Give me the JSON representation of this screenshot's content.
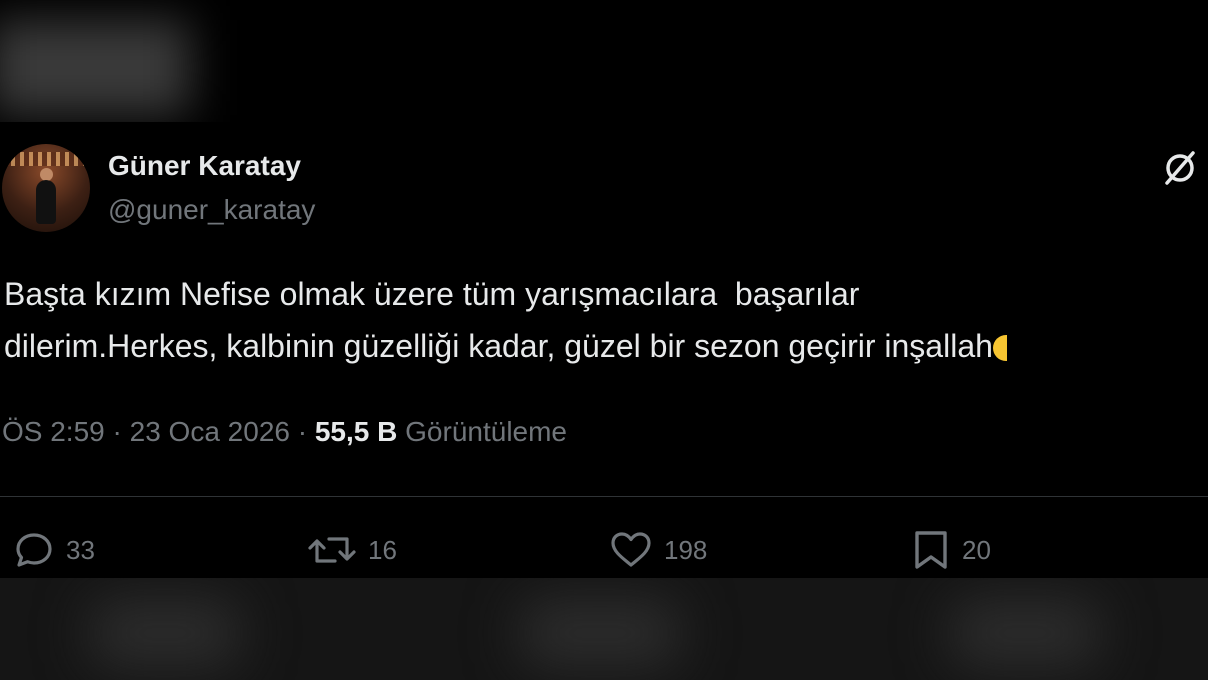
{
  "tweet": {
    "display_name": "Güner Karatay",
    "handle": "@guner_karatay",
    "text_line1": "Başta kızım Nefise olmak üzere tüm yarışmacılara  başarılar",
    "text_line2": "dilerim.Herkes, kalbinin güzelliği kadar, güzel bir sezon geçirir inşallah",
    "time": "ÖS 2:59",
    "separator": "·",
    "date": "23 Oca 2026",
    "views_count": "55,5 B",
    "views_label": "Görüntüleme"
  },
  "actions": {
    "replies": "33",
    "reposts": "16",
    "likes": "198",
    "bookmarks": "20"
  },
  "icons": {
    "header": "grok-icon",
    "reply": "reply-icon",
    "repost": "repost-icon",
    "like": "heart-icon",
    "bookmark": "bookmark-icon"
  },
  "colors": {
    "background": "#000000",
    "text": "#e7e9ea",
    "secondary": "#71767b",
    "divider": "#2f3336"
  }
}
